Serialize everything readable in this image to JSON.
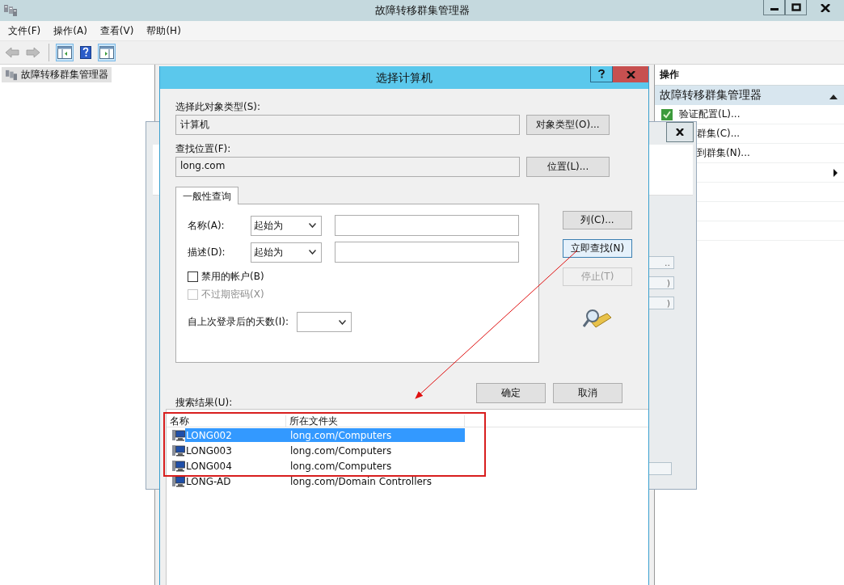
{
  "window": {
    "title": "故障转移群集管理器"
  },
  "menu": [
    "文件(F)",
    "操作(A)",
    "查看(V)",
    "帮助(H)"
  ],
  "toolbar": [
    {
      "kind": "back",
      "disabled": true,
      "selected": false
    },
    {
      "kind": "forward",
      "disabled": true,
      "selected": false
    },
    {
      "kind": "tree-pane",
      "disabled": false,
      "selected": true
    },
    {
      "kind": "help",
      "disabled": false,
      "selected": false
    },
    {
      "kind": "action-pane",
      "disabled": false,
      "selected": true
    }
  ],
  "tree": [
    {
      "label": "故障转移群集管理器",
      "selected": true
    }
  ],
  "actions": {
    "title": "操作",
    "section": {
      "title": "故障转移群集管理器",
      "expanded": true
    },
    "items": [
      {
        "kind": "validate",
        "label": "验证配置(L)...",
        "submenu": false
      },
      {
        "kind": "covered",
        "label": "群集(C)...",
        "submenu": false
      },
      {
        "kind": "covered",
        "label": "到群集(N)...",
        "submenu": false
      },
      {
        "kind": "covered",
        "submenu": true
      },
      {
        "kind": "covered",
        "submenu": false
      },
      {
        "kind": "covered",
        "submenu": false
      },
      {
        "kind": "covered",
        "submenu": false
      }
    ]
  },
  "back_window": {
    "buttons": [
      "..",
      ")",
      ")"
    ]
  },
  "dialog": {
    "title": "选择计算机",
    "object_type": {
      "label": "选择此对象类型(S):",
      "value": "计算机",
      "button": "对象类型(O)..."
    },
    "location": {
      "label": "查找位置(F):",
      "value": "long.com",
      "button": "位置(L)..."
    },
    "tabs": [
      {
        "label": "一般性查询",
        "selected": true
      }
    ],
    "queries": [
      {
        "label": "名称(A):",
        "operator": "起始为"
      },
      {
        "label": "描述(D):",
        "operator": "起始为"
      }
    ],
    "checkboxes": [
      {
        "label": "禁用的帐户(B)",
        "checked": false,
        "disabled": false
      },
      {
        "label": "不过期密码(X)",
        "checked": false,
        "disabled": true
      }
    ],
    "days": {
      "label": "自上次登录后的天数(I):"
    },
    "side_buttons": [
      {
        "label": "列(C)...",
        "disabled": false,
        "focused": false
      },
      {
        "label": "立即查找(N)",
        "disabled": false,
        "focused": true
      },
      {
        "label": "停止(T)",
        "disabled": true,
        "focused": false
      }
    ],
    "ok": "确定",
    "cancel": "取消",
    "results_label": "搜索结果(U):",
    "columns": [
      "名称",
      "所在文件夹"
    ],
    "rows": [
      {
        "name": "LONG002",
        "folder": "long.com/Computers",
        "selected": true
      },
      {
        "name": "LONG003",
        "folder": "long.com/Computers",
        "selected": false
      },
      {
        "name": "LONG004",
        "folder": "long.com/Computers",
        "selected": false
      },
      {
        "name": "LONG-AD",
        "folder": "long.com/Domain Controllers",
        "selected": false
      }
    ]
  }
}
